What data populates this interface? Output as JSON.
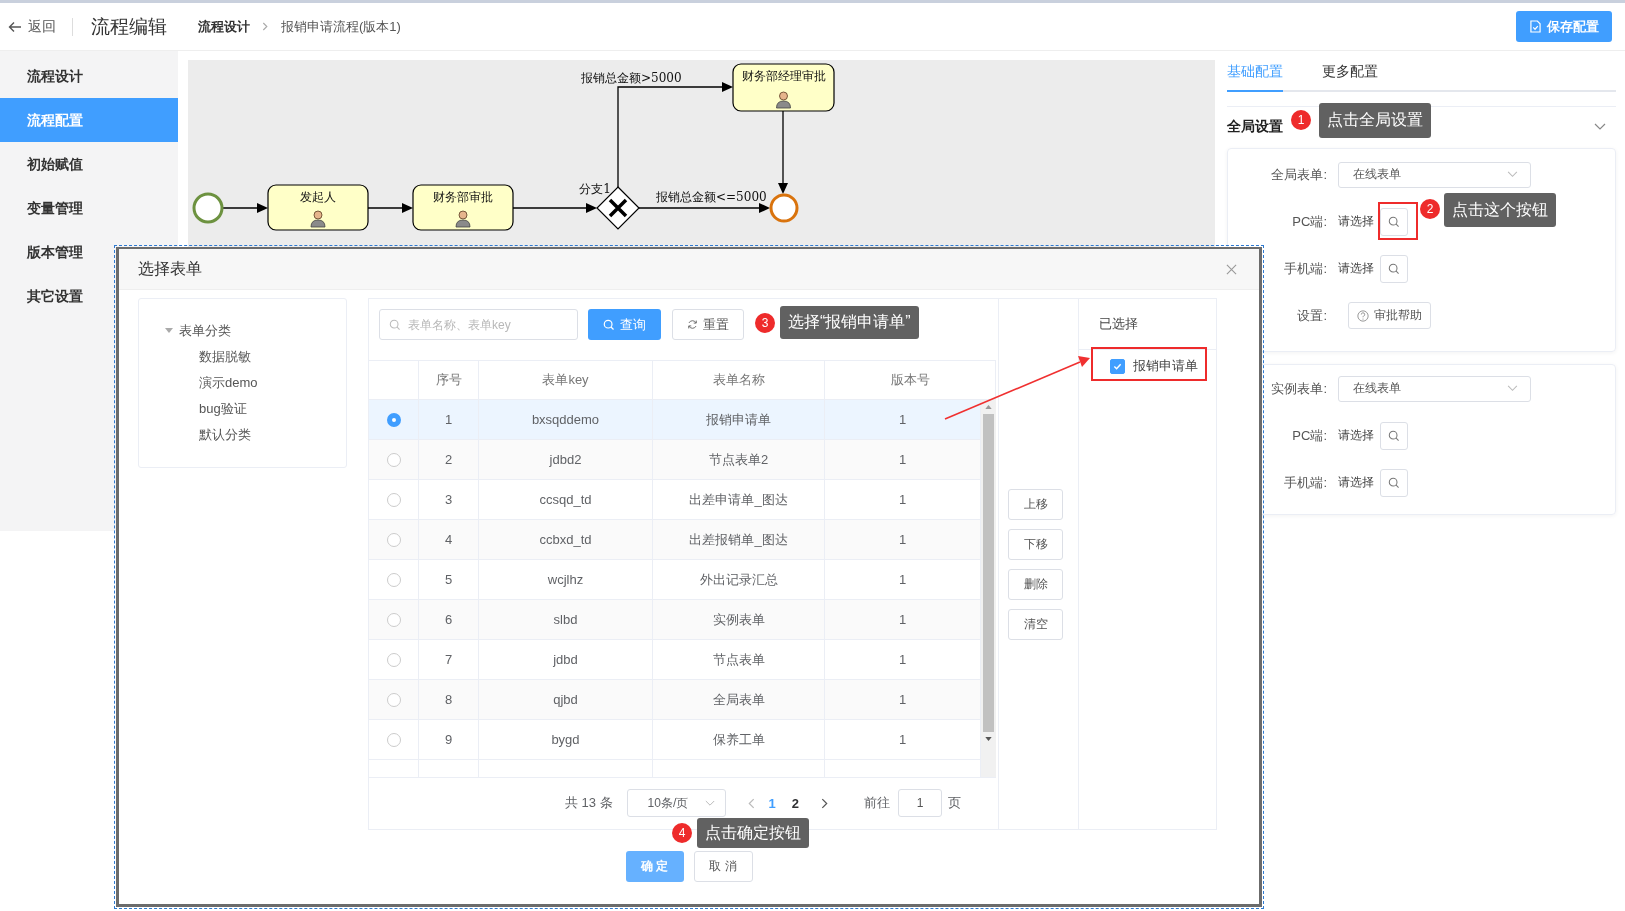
{
  "header": {
    "back": "返回",
    "title": "流程编辑",
    "breadcrumb": [
      "流程设计",
      "报销申请流程(版本1)"
    ],
    "save_button": "保存配置"
  },
  "sidebar": {
    "items": [
      {
        "label": "流程设计",
        "selected": false
      },
      {
        "label": "流程配置",
        "selected": true
      },
      {
        "label": "初始赋值",
        "selected": false
      },
      {
        "label": "变量管理",
        "selected": false
      },
      {
        "label": "版本管理",
        "selected": false
      },
      {
        "label": "其它设置",
        "selected": false
      }
    ]
  },
  "diagram": {
    "nodes": [
      {
        "kind": "start"
      },
      {
        "kind": "task",
        "label": "发起人"
      },
      {
        "kind": "task",
        "label": "财务部审批"
      },
      {
        "kind": "gateway",
        "label": "分支1"
      },
      {
        "kind": "task",
        "label": "财务部经理审批"
      },
      {
        "kind": "end"
      }
    ],
    "edge_labels": [
      "报销总金额>5000",
      "报销总金额<=5000"
    ]
  },
  "right_panel": {
    "tabs": [
      {
        "label": "基础配置",
        "selected": true
      },
      {
        "label": "更多配置",
        "selected": false
      }
    ],
    "section": {
      "title": "全局设置",
      "expanded": true
    },
    "cards": [
      {
        "rows": [
          {
            "kind": "select",
            "label": "全局表单:",
            "value": "在线表单"
          },
          {
            "kind": "picker",
            "label": "PC端:",
            "value": "请选择"
          },
          {
            "kind": "picker",
            "label": "手机端:",
            "value": "请选择"
          },
          {
            "kind": "button",
            "label": "设置:",
            "value": "审批帮助"
          }
        ]
      },
      {
        "rows": [
          {
            "kind": "select",
            "label": "实例表单:",
            "value": "在线表单"
          },
          {
            "kind": "picker",
            "label": "PC端:",
            "value": "请选择"
          },
          {
            "kind": "picker",
            "label": "手机端:",
            "value": "请选择"
          }
        ]
      }
    ]
  },
  "dialog": {
    "title": "选择表单",
    "tree": {
      "label": "表单分类",
      "expanded": true,
      "children": [
        {
          "label": "数据脱敏"
        },
        {
          "label": "演示demo"
        },
        {
          "label": "bug验证"
        },
        {
          "label": "默认分类"
        }
      ]
    },
    "search": {
      "placeholder": "表单名称、表单key"
    },
    "query_button": "查询",
    "reset_button": "重置",
    "columns": [
      "序号",
      "表单key",
      "表单名称",
      "版本号"
    ],
    "rows": [
      {
        "selected": true,
        "seq": "1",
        "key": "bxsqddemo",
        "name": "报销申请单",
        "version": "1"
      },
      {
        "selected": false,
        "seq": "2",
        "key": "jdbd2",
        "name": "节点表单2",
        "version": "1"
      },
      {
        "selected": false,
        "seq": "3",
        "key": "ccsqd_td",
        "name": "出差申请单_图达",
        "version": "1"
      },
      {
        "selected": false,
        "seq": "4",
        "key": "ccbxd_td",
        "name": "出差报销单_图达",
        "version": "1"
      },
      {
        "selected": false,
        "seq": "5",
        "key": "wcjlhz",
        "name": "外出记录汇总",
        "version": "1"
      },
      {
        "selected": false,
        "seq": "6",
        "key": "slbd",
        "name": "实例表单",
        "version": "1"
      },
      {
        "selected": false,
        "seq": "7",
        "key": "jdbd",
        "name": "节点表单",
        "version": "1"
      },
      {
        "selected": false,
        "seq": "8",
        "key": "qjbd",
        "name": "全局表单",
        "version": "1"
      },
      {
        "selected": false,
        "seq": "9",
        "key": "bygd",
        "name": "保养工单",
        "version": "1"
      }
    ],
    "pagination": {
      "total": "共 13 条",
      "page_size": "10条/页",
      "pages": [
        {
          "label": "1",
          "selected": true
        },
        {
          "label": "2",
          "selected": false
        }
      ],
      "goto": "前往",
      "page_input": "1",
      "page_unit": "页"
    },
    "move_buttons": [
      "上移",
      "下移",
      "删除",
      "清空"
    ],
    "selected_title": "已选择",
    "selected_items": [
      {
        "label": "报销申请单",
        "checked": true
      }
    ],
    "confirm_button": "确 定",
    "cancel_button": "取 消"
  },
  "guides": [
    {
      "number": "1",
      "text": "点击全局设置"
    },
    {
      "number": "2",
      "text": "点击这个按钮"
    },
    {
      "number": "3",
      "text": "选择“报销申请单”"
    },
    {
      "number": "4",
      "text": "点击确定按钮"
    }
  ]
}
